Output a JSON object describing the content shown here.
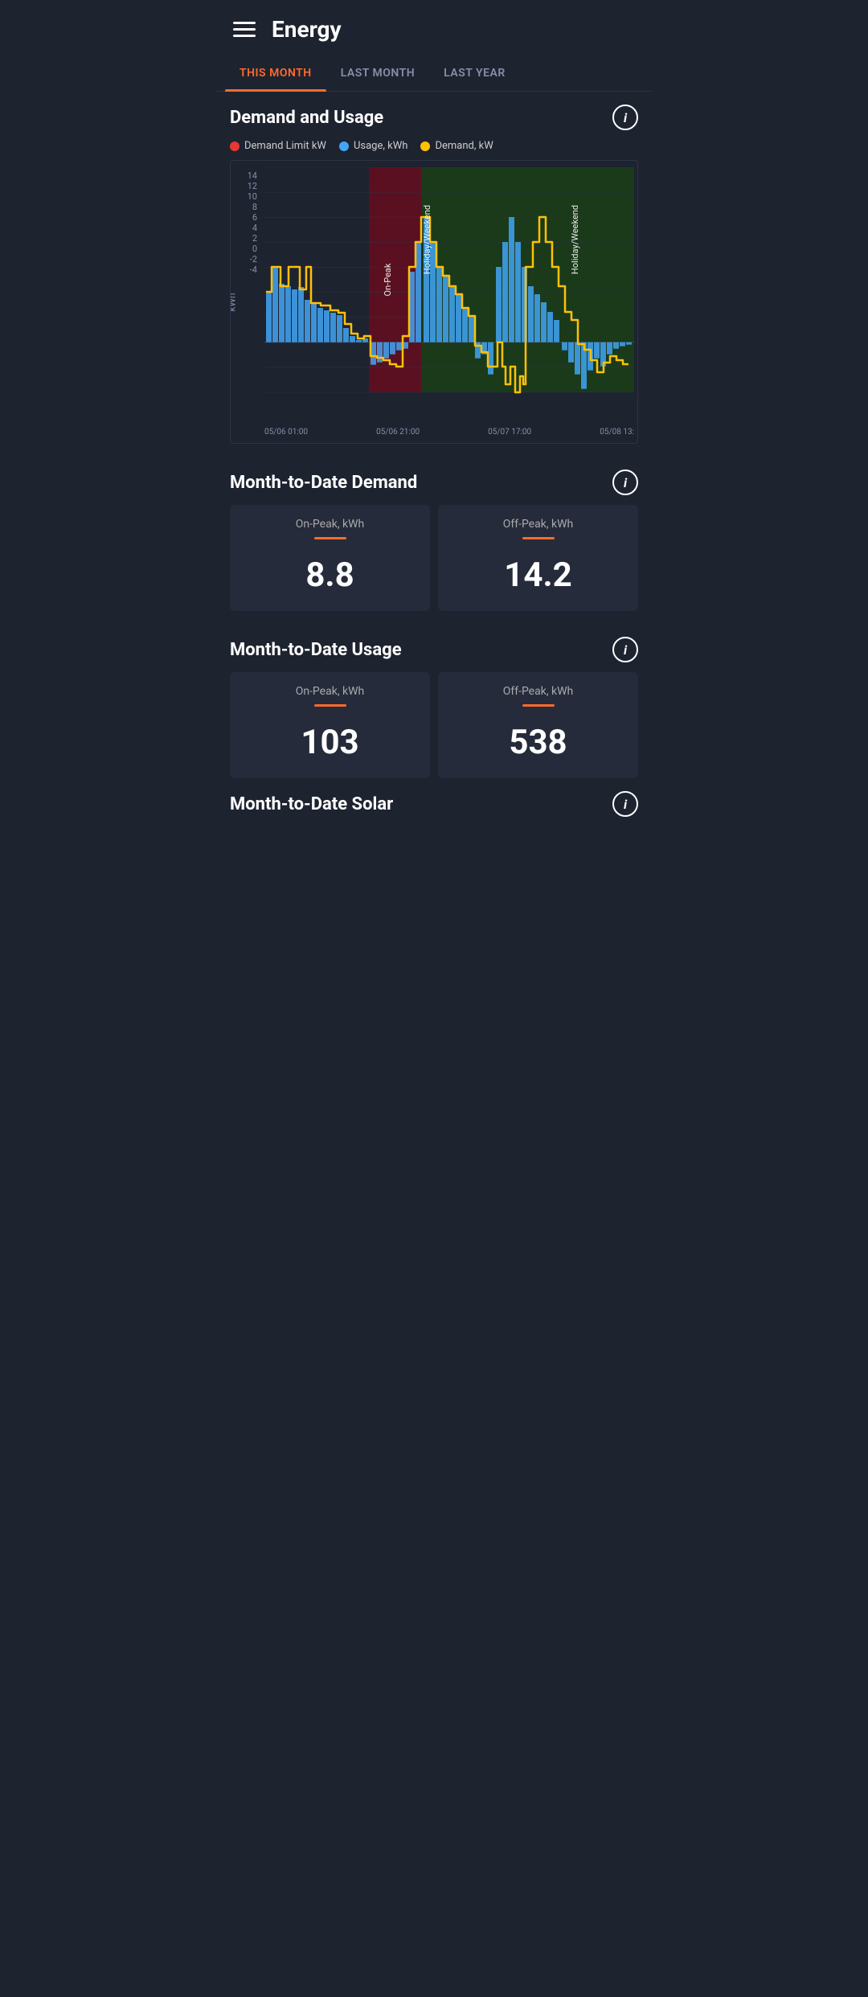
{
  "header": {
    "title": "Energy"
  },
  "tabs": [
    {
      "id": "this-month",
      "label": "THIS MONTH",
      "active": true
    },
    {
      "id": "last-month",
      "label": "LAST MONTH",
      "active": false
    },
    {
      "id": "last-year",
      "label": "LAST YEAR",
      "active": false
    }
  ],
  "demand_usage": {
    "title": "Demand and Usage",
    "info": "i",
    "legend": [
      {
        "id": "demand-limit",
        "label": "Demand Limit kW",
        "color": "red"
      },
      {
        "id": "usage",
        "label": "Usage, kWh",
        "color": "blue"
      },
      {
        "id": "demand",
        "label": "Demand, kW",
        "color": "yellow"
      }
    ],
    "y_axis": [
      "14",
      "12",
      "10",
      "8",
      "6",
      "4",
      "2",
      "0",
      "-2",
      "-4"
    ],
    "y_label": "kWh",
    "x_labels": [
      "05/06 01:00",
      "05/06 21:00",
      "05/07 17:00",
      "05/08 13:"
    ],
    "chart_regions": [
      {
        "type": "normal",
        "x_start": 0,
        "x_end": 0.28
      },
      {
        "type": "on-peak",
        "x_start": 0.28,
        "x_end": 0.42,
        "label": "On-Peak",
        "color": "#5a1a1a"
      },
      {
        "type": "normal-green",
        "x_start": 0.42,
        "x_end": 1.0,
        "color": "#1a3a1a"
      }
    ]
  },
  "month_to_date_demand": {
    "title": "Month-to-Date Demand",
    "info": "i",
    "on_peak": {
      "label": "On-Peak, kWh",
      "value": "8.8"
    },
    "off_peak": {
      "label": "Off-Peak, kWh",
      "value": "14.2"
    }
  },
  "month_to_date_usage": {
    "title": "Month-to-Date Usage",
    "info": "i",
    "on_peak": {
      "label": "On-Peak, kWh",
      "value": "103"
    },
    "off_peak": {
      "label": "Off-Peak, kWh",
      "value": "538"
    }
  },
  "month_to_date_solar": {
    "title": "Month-to-Date Solar",
    "info": "i"
  }
}
